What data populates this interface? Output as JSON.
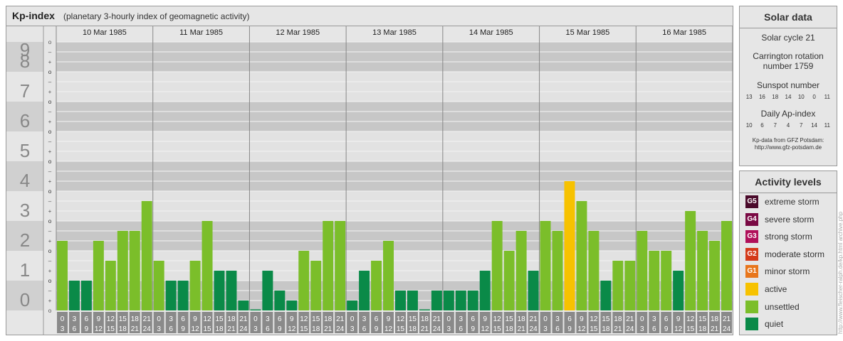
{
  "header": {
    "title": "Kp-index",
    "subtitle": "(planetary 3-hourly index of geomagnetic activity)"
  },
  "chart_data": {
    "type": "bar",
    "days": [
      "10 Mar 1985",
      "11 Mar 1985",
      "12 Mar 1985",
      "13 Mar 1985",
      "14 Mar 1985",
      "15 Mar 1985",
      "16 Mar 1985"
    ],
    "interval_labels": [
      [
        "0",
        "3"
      ],
      [
        "3",
        "6"
      ],
      [
        "6",
        "9"
      ],
      [
        "9",
        "12"
      ],
      [
        "12",
        "15"
      ],
      [
        "15",
        "18"
      ],
      [
        "18",
        "21"
      ],
      [
        "21",
        "24"
      ]
    ],
    "y_ticks": [
      "0",
      "1",
      "2",
      "3",
      "4",
      "5",
      "6",
      "7",
      "8",
      "9"
    ],
    "sub_ticks": [
      "o",
      "+",
      "–",
      "o"
    ],
    "ylim": [
      0,
      9
    ],
    "values": [
      [
        2.333,
        1.0,
        1.0,
        2.333,
        1.667,
        2.667,
        2.667,
        3.667
      ],
      [
        1.667,
        1.0,
        1.0,
        1.667,
        3.0,
        1.333,
        1.333,
        0.333
      ],
      [
        0.0,
        1.333,
        0.667,
        0.333,
        2.0,
        1.667,
        3.0,
        3.0
      ],
      [
        0.333,
        1.333,
        1.667,
        2.333,
        0.667,
        0.667,
        0.0,
        0.667
      ],
      [
        0.667,
        0.667,
        0.667,
        1.333,
        3.0,
        2.0,
        2.667,
        1.333
      ],
      [
        3.0,
        2.667,
        4.333,
        3.667,
        2.667,
        1.0,
        1.667,
        1.667
      ],
      [
        2.667,
        2.0,
        2.0,
        1.333,
        3.333,
        2.667,
        2.333,
        3.0
      ]
    ],
    "colors": {
      "quiet": "#0a8a48",
      "unsettled": "#7bbe2a",
      "active": "#f7c200",
      "band_dark": "#c7c7c7",
      "band_light": "#e2e2e2"
    }
  },
  "solar": {
    "heading": "Solar data",
    "cycle": "Solar cycle 21",
    "carrington_1": "Carrington rotation",
    "carrington_2": "number 1759",
    "sunspot_label": "Sunspot number",
    "sunspot_values": [
      "13",
      "16",
      "18",
      "14",
      "10",
      "0",
      "11"
    ],
    "ap_label": "Daily Ap-index",
    "ap_values": [
      "10",
      "6",
      "7",
      "4",
      "7",
      "14",
      "11"
    ],
    "credit_1": "Kp-data from GFZ Potsdam:",
    "credit_2": "http://www.gfz-potsdam.de"
  },
  "activity": {
    "heading": "Activity levels",
    "levels": [
      {
        "code": "G5",
        "label": "extreme storm",
        "color": "#4a0a2a"
      },
      {
        "code": "G4",
        "label": "severe storm",
        "color": "#7a0a44"
      },
      {
        "code": "G3",
        "label": "strong storm",
        "color": "#b0105a"
      },
      {
        "code": "G2",
        "label": "moderate storm",
        "color": "#d43a1a"
      },
      {
        "code": "G1",
        "label": "minor storm",
        "color": "#e8761c"
      },
      {
        "code": "",
        "label": "active",
        "color": "#f7c200"
      },
      {
        "code": "",
        "label": "unsettled",
        "color": "#7bbe2a"
      },
      {
        "code": "",
        "label": "quiet",
        "color": "#0a8a48"
      }
    ]
  },
  "watermark": "http://www.fleischer-ralph.de/kp.html  archive.php"
}
